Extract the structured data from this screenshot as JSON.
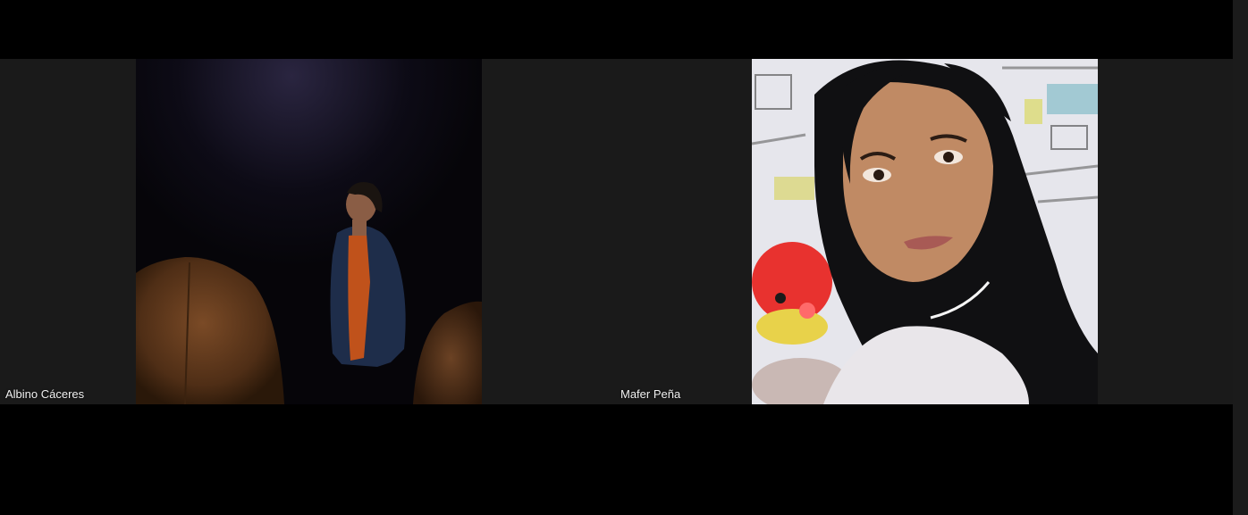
{
  "meeting": {
    "participants": [
      {
        "name": "Albino Cáceres"
      },
      {
        "name": "Mafer Peña"
      }
    ]
  },
  "colors": {
    "background": "#000000",
    "tile_background": "#1a1a1a",
    "name_label_text": "#f2f2f2"
  },
  "icons": []
}
